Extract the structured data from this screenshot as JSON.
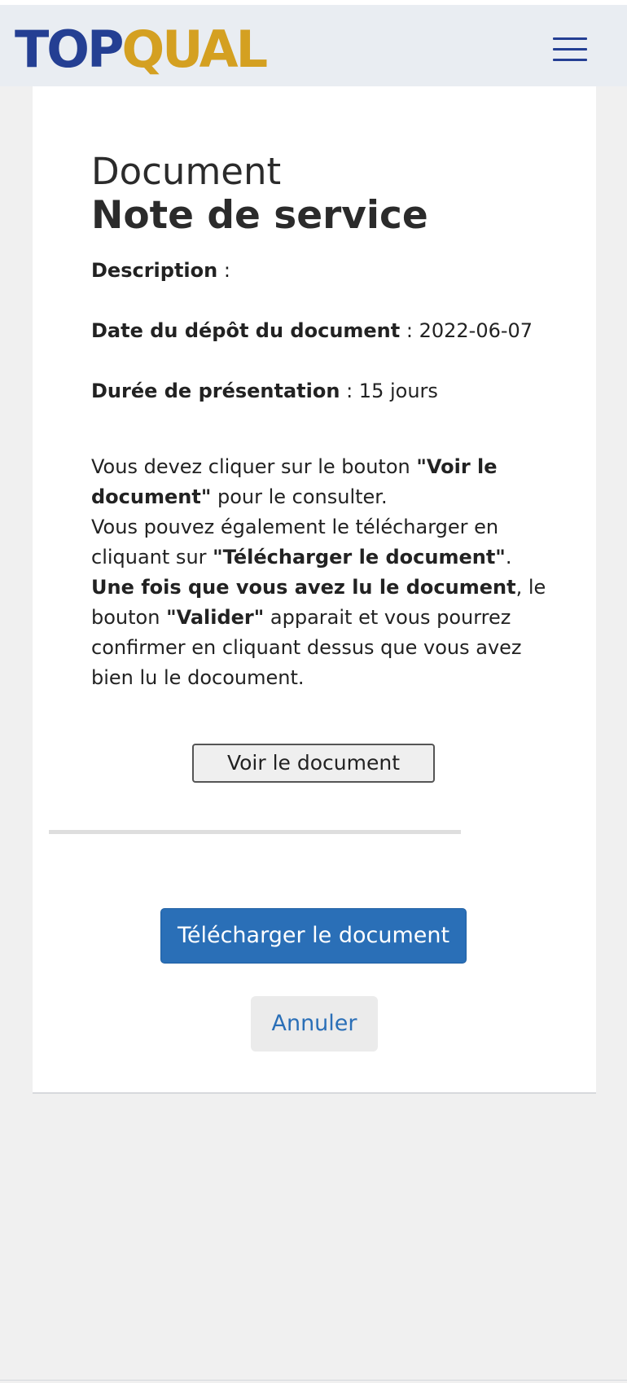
{
  "header": {
    "logo_part_a": "TOP",
    "logo_part_b": "QUAL",
    "menu_icon": "hamburger-menu-icon",
    "logo_colors": {
      "part_a": "#243f93",
      "part_b": "#d4a021"
    }
  },
  "document": {
    "kicker": "Document",
    "title": "Note de service",
    "description_label": "Description",
    "description_sep": " :",
    "description_value": "",
    "deposit_label": "Date du dépôt du document",
    "deposit_sep": " : ",
    "deposit_value": "2022-06-07",
    "duration_label": "Durée de présentation",
    "duration_sep": " : ",
    "duration_value": "15 jours"
  },
  "instructions": {
    "t1": "Vous devez cliquer sur le bouton ",
    "b1": "\"Voir le document\"",
    "t2": " pour le consulter.",
    "t3": "Vous pouvez également le télécharger en cliquant sur ",
    "b2": "\"Télécharger le document\"",
    "t4": ".",
    "b3": "Une fois que vous avez lu le document",
    "t5": ", le bouton ",
    "b4": "\"Valider\"",
    "t6": " apparait et vous pourrez confirmer en cliquant dessus que vous avez bien lu le docoument."
  },
  "actions": {
    "view_label": "Voir le document",
    "download_label": "Télécharger le document",
    "cancel_label": "Annuler"
  },
  "reading_progress": 0,
  "colors": {
    "accent": "#2a6fb7",
    "background": "#f0f0f0",
    "header_bg": "#e9edf2"
  }
}
